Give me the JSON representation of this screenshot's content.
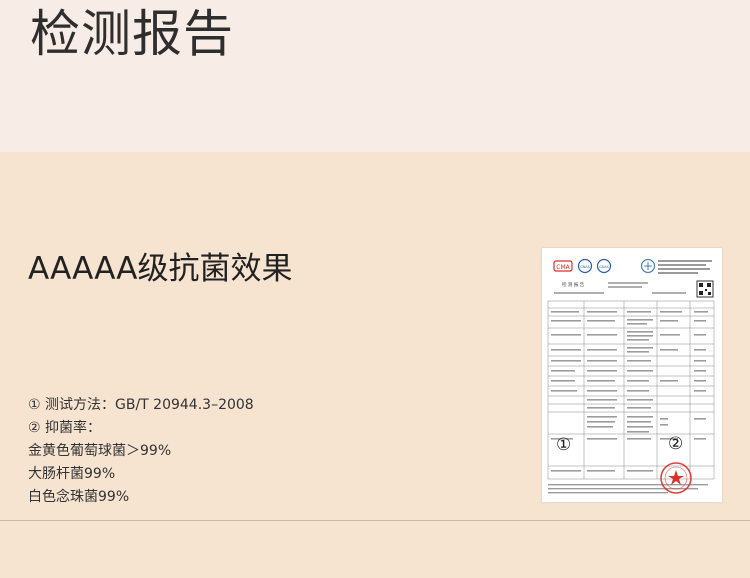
{
  "page": {
    "title": "检测报告",
    "section_title": "AAAAA级抗菌效果"
  },
  "specs": {
    "method": "① 测试方法：GB/T 20944.3–2008",
    "rate_label": "② 抑菌率：",
    "items": [
      "金黄色葡萄球菌＞99%",
      "大肠杆菌99%",
      "白色念珠菌99%"
    ]
  },
  "report": {
    "header": "检 测 报 告",
    "marker_1": "①",
    "marker_2": "②",
    "logos": [
      "CMA",
      "CNAS",
      "CAAS"
    ],
    "accent_color": "#d8322a"
  }
}
